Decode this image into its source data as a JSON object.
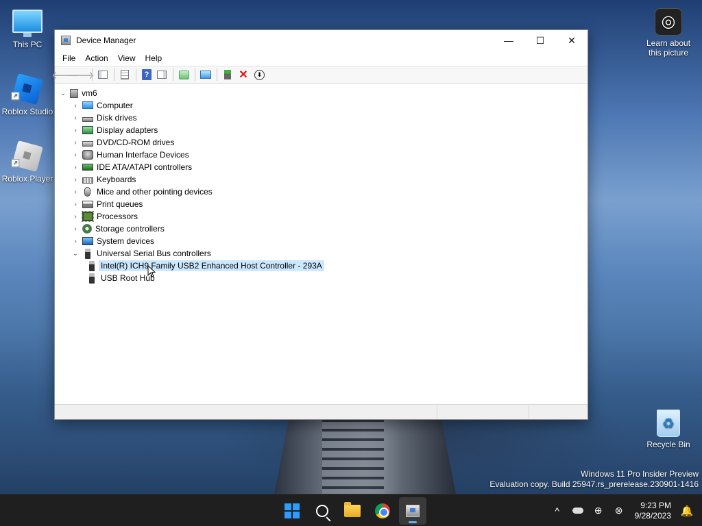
{
  "desktop": {
    "icons": [
      {
        "label": "This PC"
      },
      {
        "label": "Roblox Studio"
      },
      {
        "label": "Roblox Player"
      },
      {
        "label": "Recycle Bin"
      },
      {
        "label": "Learn about this picture"
      }
    ],
    "watermark": {
      "line1": "Windows 11 Pro Insider Preview",
      "line2": "Evaluation copy. Build 25947.rs_prerelease.230901-1416"
    }
  },
  "window": {
    "title": "Device Manager",
    "controls": {
      "minimize": "—",
      "maximize": "☐",
      "close": "✕"
    },
    "menu": [
      "File",
      "Action",
      "View",
      "Help"
    ],
    "toolbar": {
      "back": "🡐",
      "forward": "🡒",
      "help": "?",
      "remove": "✕",
      "download": "⬇"
    },
    "tree": {
      "root": {
        "label": "vm6",
        "expander": "⌄"
      },
      "categories": [
        {
          "label": "Computer",
          "icon": "computer-icon",
          "expander": "›"
        },
        {
          "label": "Disk drives",
          "icon": "disk-drive-icon",
          "expander": "›"
        },
        {
          "label": "Display adapters",
          "icon": "display-adapter-icon",
          "expander": "›"
        },
        {
          "label": "DVD/CD-ROM drives",
          "icon": "dvd-drive-icon",
          "expander": "›"
        },
        {
          "label": "Human Interface Devices",
          "icon": "hid-icon",
          "expander": "›"
        },
        {
          "label": "IDE ATA/ATAPI controllers",
          "icon": "ide-controller-icon",
          "expander": "›"
        },
        {
          "label": "Keyboards",
          "icon": "keyboard-icon",
          "expander": "›"
        },
        {
          "label": "Mice and other pointing devices",
          "icon": "mouse-icon",
          "expander": "›"
        },
        {
          "label": "Print queues",
          "icon": "printer-icon",
          "expander": "›"
        },
        {
          "label": "Processors",
          "icon": "processor-icon",
          "expander": "›"
        },
        {
          "label": "Storage controllers",
          "icon": "storage-controller-icon",
          "expander": "›"
        },
        {
          "label": "System devices",
          "icon": "system-device-icon",
          "expander": "›"
        },
        {
          "label": "Universal Serial Bus controllers",
          "icon": "usb-icon",
          "expander": "⌄"
        }
      ],
      "usb_children": [
        {
          "label": "Intel(R) ICH9 Family USB2 Enhanced Host Controller - 293A",
          "selected": true
        },
        {
          "label": "USB Root Hub",
          "selected": false
        }
      ]
    }
  },
  "taskbar": {
    "clock": {
      "time": "9:23 PM",
      "date": "9/28/2023"
    },
    "tray": {
      "chevron": "^",
      "network": "⊕",
      "language": "⊗"
    },
    "accent_color": "#5fb2f2"
  },
  "colors": {
    "selection": "#cce8ff",
    "start_blue": "#2f9bff"
  }
}
